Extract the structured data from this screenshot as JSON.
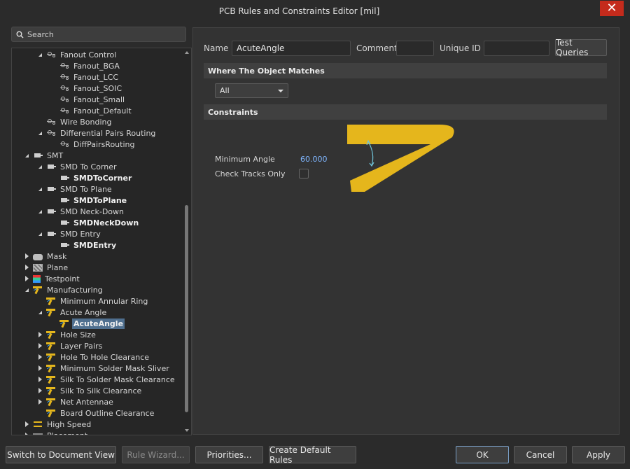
{
  "window": {
    "title": "PCB Rules and Constraints Editor [mil]"
  },
  "search": {
    "placeholder": "Search"
  },
  "tree": [
    {
      "label": "Fanout Control",
      "level": 1,
      "toggle": "expanded",
      "icon": "fanout-icon",
      "bold": false
    },
    {
      "label": "Fanout_BGA",
      "level": 2,
      "toggle": "none",
      "icon": "fanout-icon",
      "bold": false
    },
    {
      "label": "Fanout_LCC",
      "level": 2,
      "toggle": "none",
      "icon": "fanout-icon",
      "bold": false
    },
    {
      "label": "Fanout_SOIC",
      "level": 2,
      "toggle": "none",
      "icon": "fanout-icon",
      "bold": false
    },
    {
      "label": "Fanout_Small",
      "level": 2,
      "toggle": "none",
      "icon": "fanout-icon",
      "bold": false
    },
    {
      "label": "Fanout_Default",
      "level": 2,
      "toggle": "none",
      "icon": "fanout-icon",
      "bold": false
    },
    {
      "label": "Wire Bonding",
      "level": 1,
      "toggle": "none",
      "icon": "fanout-icon",
      "bold": false
    },
    {
      "label": "Differential Pairs Routing",
      "level": 1,
      "toggle": "expanded",
      "icon": "fanout-icon",
      "bold": false
    },
    {
      "label": "DiffPairsRouting",
      "level": 2,
      "toggle": "none",
      "icon": "fanout-icon",
      "bold": false
    },
    {
      "label": "SMT",
      "level": 0,
      "toggle": "expanded",
      "icon": "smt-icon",
      "bold": false
    },
    {
      "label": "SMD To Corner",
      "level": 1,
      "toggle": "expanded",
      "icon": "smt-icon",
      "bold": false
    },
    {
      "label": "SMDToCorner",
      "level": 2,
      "toggle": "none",
      "icon": "smt-icon",
      "bold": true
    },
    {
      "label": "SMD To Plane",
      "level": 1,
      "toggle": "expanded",
      "icon": "smt-icon",
      "bold": false
    },
    {
      "label": "SMDToPlane",
      "level": 2,
      "toggle": "none",
      "icon": "smt-icon",
      "bold": true
    },
    {
      "label": "SMD Neck-Down",
      "level": 1,
      "toggle": "expanded",
      "icon": "smt-icon",
      "bold": false
    },
    {
      "label": "SMDNeckDown",
      "level": 2,
      "toggle": "none",
      "icon": "smt-icon",
      "bold": true
    },
    {
      "label": "SMD Entry",
      "level": 1,
      "toggle": "expanded",
      "icon": "smt-icon",
      "bold": false
    },
    {
      "label": "SMDEntry",
      "level": 2,
      "toggle": "none",
      "icon": "smt-icon",
      "bold": true
    },
    {
      "label": "Mask",
      "level": 0,
      "toggle": "collapsed",
      "icon": "mask-icon",
      "bold": false
    },
    {
      "label": "Plane",
      "level": 0,
      "toggle": "collapsed",
      "icon": "plane-icon",
      "bold": false
    },
    {
      "label": "Testpoint",
      "level": 0,
      "toggle": "collapsed",
      "icon": "testpoint-icon",
      "bold": false
    },
    {
      "label": "Manufacturing",
      "level": 0,
      "toggle": "expanded",
      "icon": "manufacturing-icon",
      "bold": false
    },
    {
      "label": "Minimum Annular Ring",
      "level": 1,
      "toggle": "none",
      "icon": "manufacturing-icon",
      "bold": false
    },
    {
      "label": "Acute Angle",
      "level": 1,
      "toggle": "expanded",
      "icon": "manufacturing-icon",
      "bold": false
    },
    {
      "label": "AcuteAngle",
      "level": 2,
      "toggle": "none",
      "icon": "manufacturing-icon",
      "bold": true,
      "selected": true
    },
    {
      "label": "Hole Size",
      "level": 1,
      "toggle": "collapsed",
      "icon": "manufacturing-icon",
      "bold": false
    },
    {
      "label": "Layer Pairs",
      "level": 1,
      "toggle": "collapsed",
      "icon": "manufacturing-icon",
      "bold": false
    },
    {
      "label": "Hole To Hole Clearance",
      "level": 1,
      "toggle": "collapsed",
      "icon": "manufacturing-icon",
      "bold": false
    },
    {
      "label": "Minimum Solder Mask Sliver",
      "level": 1,
      "toggle": "collapsed",
      "icon": "manufacturing-icon",
      "bold": false
    },
    {
      "label": "Silk To Solder Mask Clearance",
      "level": 1,
      "toggle": "collapsed",
      "icon": "manufacturing-icon",
      "bold": false
    },
    {
      "label": "Silk To Silk Clearance",
      "level": 1,
      "toggle": "collapsed",
      "icon": "manufacturing-icon",
      "bold": false
    },
    {
      "label": "Net Antennae",
      "level": 1,
      "toggle": "collapsed",
      "icon": "manufacturing-icon",
      "bold": false
    },
    {
      "label": "Board Outline Clearance",
      "level": 1,
      "toggle": "none",
      "icon": "manufacturing-icon",
      "bold": false
    },
    {
      "label": "High Speed",
      "level": 0,
      "toggle": "collapsed",
      "icon": "high-speed-icon",
      "bold": false
    },
    {
      "label": "Placement",
      "level": 0,
      "toggle": "collapsed",
      "icon": "placement-icon",
      "bold": false
    }
  ],
  "rule": {
    "name_label": "Name",
    "name_value": "AcuteAngle",
    "comment_label": "Comment",
    "comment_value": "",
    "unique_id_label": "Unique ID",
    "unique_id_value": "",
    "test_queries_label": "Test Queries"
  },
  "where_matches": {
    "header": "Where The Object Matches",
    "selected": "All"
  },
  "constraints": {
    "header": "Constraints",
    "min_angle_label": "Minimum Angle",
    "min_angle_value": "60.000",
    "check_tracks_label": "Check Tracks Only",
    "check_tracks_only": false,
    "graphic_color": "#e5b61c",
    "arc_color": "#6fc3d8"
  },
  "footer": {
    "switch_view": "Switch to Document View",
    "rule_wizard": "Rule Wizard...",
    "priorities": "Priorities...",
    "create_default": "Create Default Rules",
    "ok": "OK",
    "cancel": "Cancel",
    "apply": "Apply"
  },
  "colors": {
    "selection": "#4f6f8f",
    "close": "#c42b1c",
    "value": "#7fb6ff"
  }
}
